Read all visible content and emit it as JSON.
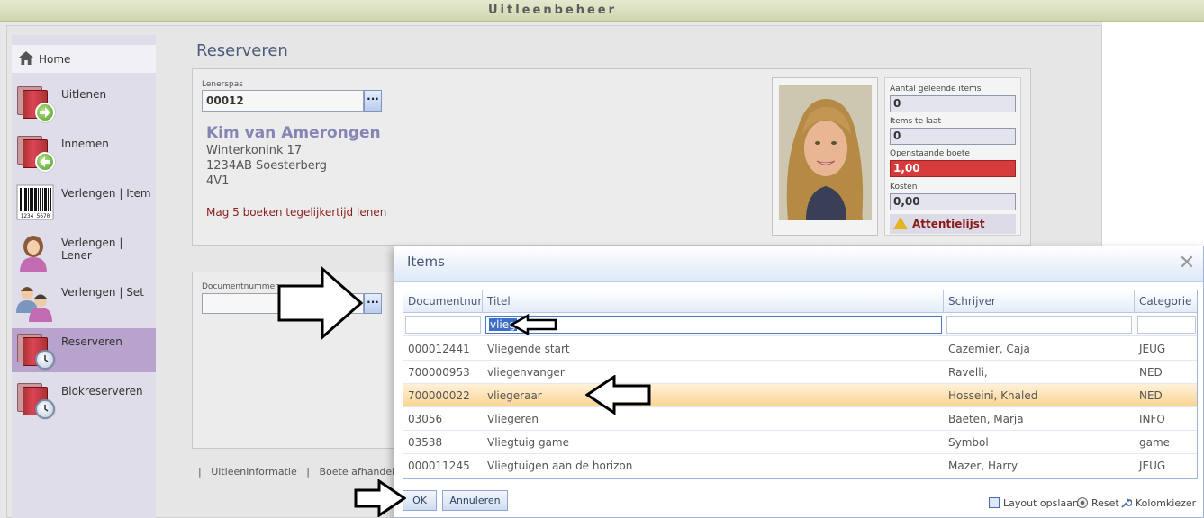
{
  "app": {
    "title": "Uitleenbeheer"
  },
  "sidebar": {
    "home_label": "Home",
    "items": [
      {
        "label": "Uitlenen",
        "icon": "book-arrow-right-icon"
      },
      {
        "label": "Innemen",
        "icon": "book-arrow-left-icon"
      },
      {
        "label": "Verlengen | Item",
        "icon": "barcode-icon"
      },
      {
        "label": "Verlengen | Lener",
        "icon": "person-icon"
      },
      {
        "label": "Verlengen | Set",
        "icon": "group-icon"
      },
      {
        "label": "Reserveren",
        "icon": "book-clock-icon",
        "active": true
      },
      {
        "label": "Blokreserveren",
        "icon": "book-clock-icon"
      }
    ],
    "barcode_digits": "1234 5670"
  },
  "page": {
    "title": "Reserveren"
  },
  "lener": {
    "card_label": "Lenerspas",
    "card_number": "00012",
    "name": "Kim van Amerongen",
    "address_line1": "Winterkonink 17",
    "address_line2": "1234AB  Soesterberg",
    "group": "4V1",
    "note": "Mag 5 boeken tegelijkertijd lenen"
  },
  "stats": {
    "aantal_label": "Aantal geleende items",
    "aantal_value": "0",
    "te_laat_label": "Items te laat",
    "te_laat_value": "0",
    "boete_label": "Openstaande boete",
    "boete_value": "1,00",
    "kosten_label": "Kosten",
    "kosten_value": "0,00",
    "attentie_label": "Attentielijst"
  },
  "document": {
    "label": "Documentnummer",
    "value": ""
  },
  "bottom_links": {
    "sep": "|",
    "items": [
      "Uitleeninformatie",
      "Boete afhandelen"
    ]
  },
  "colors": {
    "accent": "#b8a3cc",
    "warning_red": "#d63b3b",
    "selected_row": "#fbd392"
  },
  "dialog": {
    "title": "Items",
    "columns": [
      "Documentnummer",
      "Titel",
      "Schrijver",
      "Categorie"
    ],
    "filter_titel": "vlieg",
    "rows": [
      {
        "doc": "000012441",
        "titel": "Vliegende start",
        "schrijver": "Cazemier, Caja",
        "categorie": "JEUG"
      },
      {
        "doc": "700000953",
        "titel": "vliegenvanger",
        "schrijver": "Ravelli,",
        "categorie": "NED"
      },
      {
        "doc": "700000022",
        "titel": "vliegeraar",
        "schrijver": "Hosseini, Khaled",
        "categorie": "NED",
        "selected": true
      },
      {
        "doc": "03056",
        "titel": "Vliegeren",
        "schrijver": "Baeten, Marja",
        "categorie": "INFO"
      },
      {
        "doc": "03538",
        "titel": "Vliegtuig game",
        "schrijver": "Symbol",
        "categorie": "game"
      },
      {
        "doc": "000011245",
        "titel": "Vliegtuigen aan de horizon",
        "schrijver": "Mazer, Harry",
        "categorie": "JEUG"
      }
    ],
    "ok_label": "OK",
    "cancel_label": "Annuleren",
    "layout_save_label": "Layout opslaan",
    "reset_label": "Reset",
    "column_chooser_label": "Kolomkiezer"
  }
}
